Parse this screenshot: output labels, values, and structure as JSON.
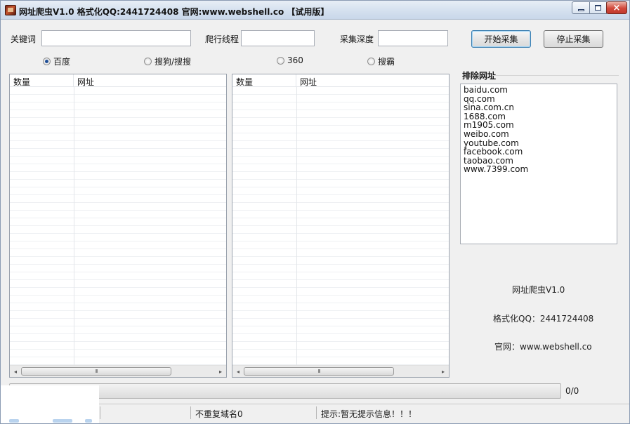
{
  "window": {
    "title": "网址爬虫V1.0 格式化QQ:2441724408 官网:www.webshell.co 【试用版】",
    "controls": {
      "minimize": "minimize",
      "maximize": "maximize",
      "close": "×"
    }
  },
  "form": {
    "keyword_label": "关键词",
    "keyword_value": "",
    "threads_label": "爬行线程",
    "threads_value": "",
    "depth_label": "采集深度",
    "depth_value": "",
    "start_button": "开始采集",
    "stop_button": "停止采集"
  },
  "engines": [
    {
      "label": "百度",
      "selected": true
    },
    {
      "label": "搜狗/搜搜",
      "selected": false
    },
    {
      "label": "360",
      "selected": false
    },
    {
      "label": "搜霸",
      "selected": false
    }
  ],
  "lists": {
    "left": {
      "columns": [
        "数量",
        "网址"
      ],
      "rows": []
    },
    "right": {
      "columns": [
        "数量",
        "网址"
      ],
      "rows": []
    },
    "scroll_left": "◂",
    "scroll_right": "▸",
    "thumb_grip": "III"
  },
  "exclude": {
    "title": "排除网址",
    "urls": [
      "baidu.com",
      "qq.com",
      "sina.com.cn",
      "1688.com",
      "m1905.com",
      "weibo.com",
      "youtube.com",
      "facebook.com",
      "taobao.com",
      "www.7399.com"
    ]
  },
  "info": {
    "app_name": "网址爬虫V1.0",
    "qq": "格式化QQ：2441724408",
    "site": "官网：www.webshell.co"
  },
  "progress": {
    "fraction": 0,
    "count_text": "0/0"
  },
  "status": {
    "unique_domains": "不重复域名0",
    "hint": "提示:暂无提示信息！！！"
  },
  "colors": {
    "progress_green": "#06b025",
    "title_bar": "#d3dfee",
    "window_bg": "#f0f0f0"
  }
}
